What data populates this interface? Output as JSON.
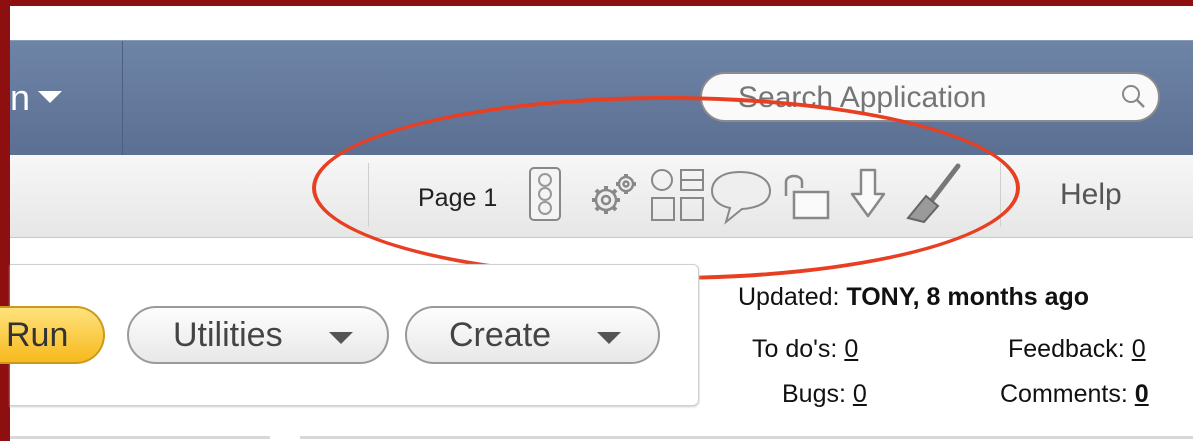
{
  "nav": {
    "menu_partial_label": "n"
  },
  "search": {
    "placeholder": "Search Application"
  },
  "toolbar": {
    "page_label": "Page 1",
    "icons": [
      "traffic-light-icon",
      "gear-icon",
      "layout-icon",
      "speech-bubble-icon",
      "unlock-icon",
      "download-arrow-icon",
      "broom-icon"
    ],
    "help_label": "Help"
  },
  "actions": {
    "run_label": "Run",
    "utilities_label": "Utilities",
    "create_label": "Create"
  },
  "meta": {
    "updated_label": "Updated:",
    "updated_value": "TONY, 8 months ago",
    "todos_label": "To do's:",
    "todos_value": "0",
    "feedback_label": "Feedback:",
    "feedback_value": "0",
    "bugs_label": "Bugs:",
    "bugs_value": "0",
    "comments_label": "Comments:",
    "comments_value": "0"
  },
  "colors": {
    "frame": "#8e0f0f",
    "navbar": "#5b6f92",
    "annotation": "#e83f22",
    "run_button": "#f7b91d"
  }
}
